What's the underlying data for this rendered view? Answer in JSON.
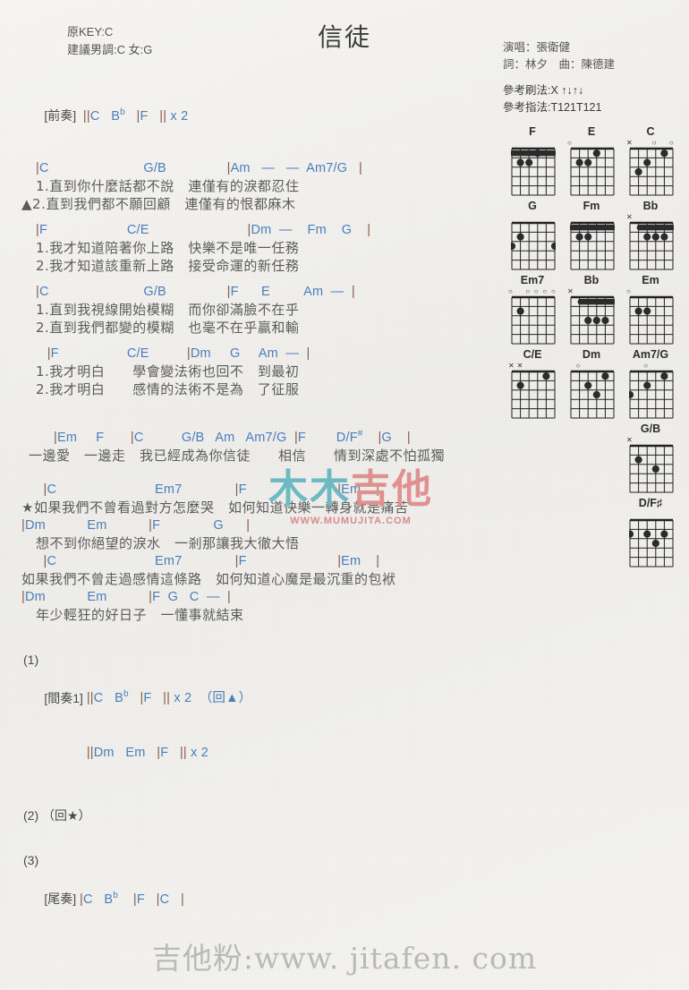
{
  "header": {
    "title": "信徒",
    "key_original": "原KEY:C",
    "key_suggested": "建議男調:C 女:G",
    "singer": "演唱：張衛健",
    "writers": "詞：林夕　曲：陳德建",
    "strumming": "參考刷法:X ↑↓↑↓",
    "fingering": "參考指法:T121T121"
  },
  "sections": {
    "intro_label": "[前奏]",
    "intro_chords": "||C   B♭   |F   || x 2",
    "v1": {
      "chords_a": "|C                         G/B                |Am   —   —  Am7/G   |",
      "lyric_a1": "1.直到你什麼話都不說　連僅有的淚都忍住",
      "lyric_a2": "▲2.直到我們都不願回顧　連僅有的恨都麻木",
      "chords_b": "|F                     C/E                          |Dm  —    Fm    G    |",
      "lyric_b1": "1.我才知道陪著你上路　快樂不是唯一任務",
      "lyric_b2": "2.我才知道該重新上路　接受命運的新任務",
      "chords_c": "|C                         G/B                |F      E         Am  —  |",
      "lyric_c1": "1.直到我視線開始模糊　而你卻滿臉不在乎",
      "lyric_c2": "2.直到我們都變的模糊　也毫不在乎贏和輸",
      "chords_d": "   |F                  C/E          |Dm     G     Am  —  |",
      "lyric_d1": "1.我才明白　　學會變法術也回不　到最初",
      "lyric_d2": "2.我才明白　　感情的法術不是為　了征服"
    },
    "bridge": {
      "chords": "|Em     F       |C          G/B   Am   Am7/G  |F        D/F♯    |G    |",
      "lyric": "一邊愛　一邊走　我已經成為你信徒　　相信　　情到深處不怕孤獨"
    },
    "chorus": {
      "chords_a": "  |C                          Em7              |F                        |Em    |",
      "lyric_a": "★如果我們不曾看過對方怎麼哭　如何知道快樂一轉身就是痛苦",
      "chords_b": "|Dm           Em           |F              G      |",
      "lyric_b": "想不到你絕望的淚水　一剎那讓我大徹大悟",
      "chords_c": "  |C                          Em7              |F                        |Em    |",
      "lyric_c": "如果我們不曾走過感情這條路　如何知道心魔是最沉重的包袱",
      "chords_d": "|Dm           Em           |F  G   C  —  |",
      "lyric_d": "年少輕狂的好日子　一懂事就結束"
    },
    "repeat1_num": "(1)",
    "interlude_label": "[間奏1]",
    "interlude_line1": "||C   B♭   |F   || x 2  （回▲）",
    "interlude_line2": "||Dm   Em   |F   || x 2",
    "repeat2_num": "(2) （回★）",
    "repeat3_num": "(3)",
    "outro_label": "[尾奏]",
    "outro_chords": "|C   B♭    |F   |C   |"
  },
  "chord_diagrams": [
    [
      {
        "name": "F",
        "marks": [],
        "barre": {
          "fret": 1,
          "from": 0,
          "to": 5
        },
        "dots": [
          {
            "s": 1,
            "f": 2
          },
          {
            "s": 2,
            "f": 2
          },
          {
            "s": 3,
            "f": 1
          }
        ]
      },
      {
        "name": "E",
        "marks": [
          {
            "sym": "○",
            "s": 0
          }
        ],
        "dots": [
          {
            "s": 1,
            "f": 2
          },
          {
            "s": 2,
            "f": 2
          },
          {
            "s": 3,
            "f": 1
          }
        ]
      },
      {
        "name": "C",
        "marks": [
          {
            "sym": "✕",
            "s": 0
          },
          {
            "sym": "○",
            "s": 3
          },
          {
            "sym": "○",
            "s": 5
          }
        ],
        "dots": [
          {
            "s": 1,
            "f": 3
          },
          {
            "s": 2,
            "f": 2
          },
          {
            "s": 4,
            "f": 1
          }
        ]
      }
    ],
    [
      {
        "name": "G",
        "marks": [],
        "dots": [
          {
            "s": 0,
            "f": 3
          },
          {
            "s": 1,
            "f": 2
          },
          {
            "s": 5,
            "f": 3
          }
        ]
      },
      {
        "name": "Fm",
        "marks": [],
        "barre": {
          "fret": 1,
          "from": 0,
          "to": 5
        },
        "dots": [
          {
            "s": 1,
            "f": 2
          },
          {
            "s": 2,
            "f": 2
          }
        ]
      },
      {
        "name": "Bb",
        "marks": [
          {
            "sym": "✕",
            "s": 0
          }
        ],
        "barre": {
          "fret": 1,
          "from": 1,
          "to": 5
        },
        "dots": [
          {
            "s": 2,
            "f": 2
          },
          {
            "s": 3,
            "f": 2
          },
          {
            "s": 4,
            "f": 2
          }
        ]
      }
    ],
    [
      {
        "name": "Em7",
        "marks": [
          {
            "sym": "○",
            "s": 0
          },
          {
            "sym": "○",
            "s": 2
          },
          {
            "sym": "○",
            "s": 3
          },
          {
            "sym": "○",
            "s": 4
          },
          {
            "sym": "○",
            "s": 5
          }
        ],
        "dots": [
          {
            "s": 1,
            "f": 2
          }
        ]
      },
      {
        "name": "Bb",
        "marks": [
          {
            "sym": "✕",
            "s": 0
          }
        ],
        "barre": {
          "fret": 1,
          "from": 1,
          "to": 5
        },
        "dots": [
          {
            "s": 2,
            "f": 3
          },
          {
            "s": 3,
            "f": 3
          },
          {
            "s": 4,
            "f": 3
          }
        ]
      },
      {
        "name": "Em",
        "marks": [
          {
            "sym": "○",
            "s": 0
          }
        ],
        "dots": [
          {
            "s": 1,
            "f": 2
          },
          {
            "s": 2,
            "f": 2
          }
        ]
      }
    ],
    [
      {
        "name": "C/E",
        "marks": [
          {
            "sym": "✕",
            "s": 0
          },
          {
            "sym": "✕",
            "s": 1
          }
        ],
        "dots": [
          {
            "s": 1,
            "f": 2
          },
          {
            "s": 4,
            "f": 1
          }
        ]
      },
      {
        "name": "Dm",
        "marks": [
          {
            "sym": "○",
            "s": 1
          }
        ],
        "dots": [
          {
            "s": 2,
            "f": 2
          },
          {
            "s": 3,
            "f": 3
          },
          {
            "s": 4,
            "f": 1
          }
        ]
      },
      {
        "name": "Am7/G",
        "marks": [
          {
            "sym": "○",
            "s": 2
          }
        ],
        "dots": [
          {
            "s": 0,
            "f": 3
          },
          {
            "s": 2,
            "f": 2
          },
          {
            "s": 4,
            "f": 1
          }
        ]
      }
    ],
    [
      {
        "name": "G/B",
        "marks": [
          {
            "sym": "✕",
            "s": 0
          }
        ],
        "dots": [
          {
            "s": 1,
            "f": 2
          },
          {
            "s": 3,
            "f": 3
          }
        ],
        "align": "right"
      }
    ],
    [
      {
        "name": "D/F♯",
        "marks": [],
        "dots": [
          {
            "s": 0,
            "f": 2
          },
          {
            "s": 2,
            "f": 2
          },
          {
            "s": 3,
            "f": 3
          },
          {
            "s": 4,
            "f": 2
          }
        ],
        "align": "right"
      }
    ]
  ],
  "watermarks": {
    "center_main": "木木吉他",
    "center_sub": "WWW.MUMUJITA.COM",
    "center_color_green": "#6fb9c4",
    "center_color_red": "#e0918f",
    "bottom": "吉他粉:www. jitafen. com"
  }
}
